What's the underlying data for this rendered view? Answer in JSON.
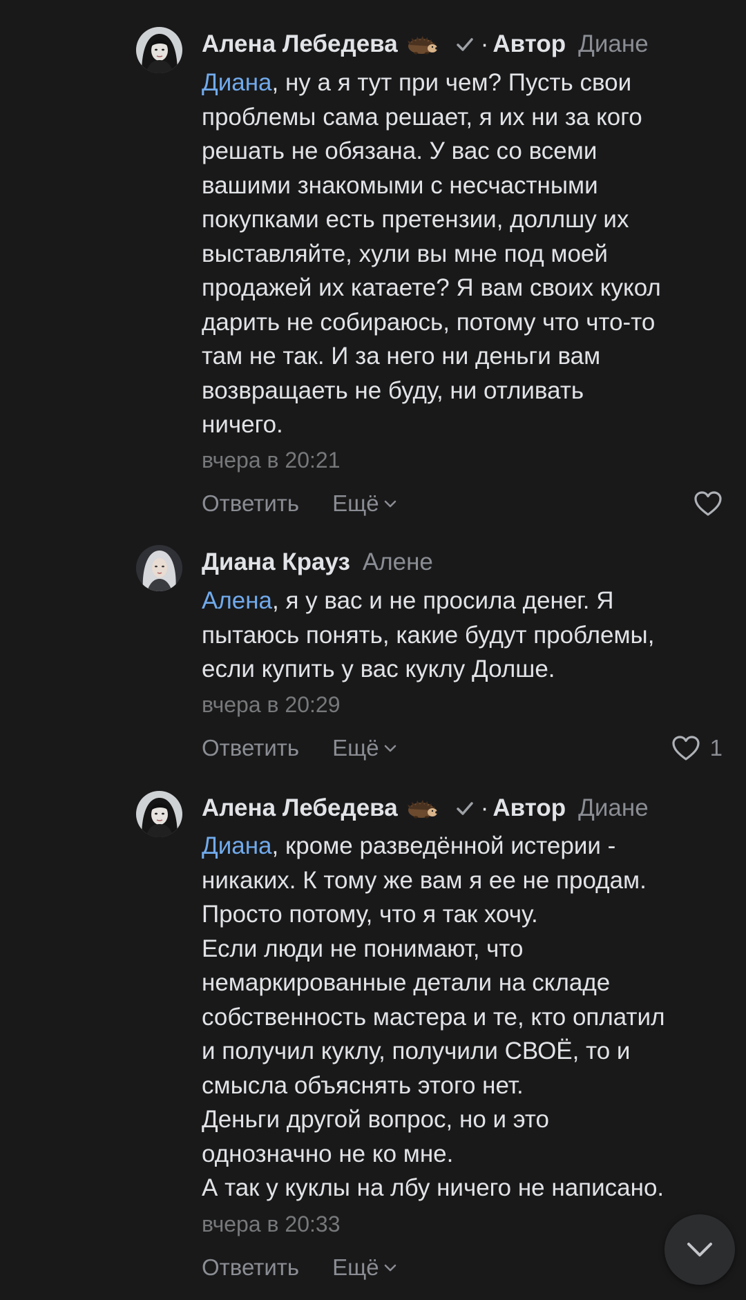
{
  "comments": [
    {
      "author": "Алена Лебедева",
      "badge_emoji": "hedgehog-icon",
      "verified": true,
      "role": "Автор",
      "dot": "·",
      "reply_to": "Диане",
      "mention": "Диана",
      "lines": [
        ", ну а я тут при чем? Пусть свои",
        "проблемы сама решает, я их ни за кого",
        "решать не обязана. У вас со всеми",
        "вашими знакомыми с несчастными",
        "покупками есть претензии, доллшу их",
        "выставляйте, хули вы мне под моей",
        "продажей их катаете? Я вам своих кукол",
        "дарить не собираюсь, потому что что-то",
        "там не так. И за него ни деньги вам",
        "возвращаеть не буду, ни отливать",
        "ничего."
      ],
      "time": "вчера в 20:21",
      "reply_label": "Ответить",
      "more_label": "Ещё",
      "likes": ""
    },
    {
      "author": "Диана Крауз",
      "reply_to": "Алене",
      "mention": "Алена",
      "lines": [
        ", я у вас и не просила денег. Я",
        "пытаюсь понять, какие будут проблемы,",
        "если купить у вас куклу Долше."
      ],
      "time": "вчера в 20:29",
      "reply_label": "Ответить",
      "more_label": "Ещё",
      "likes": "1"
    },
    {
      "author": "Алена Лебедева",
      "badge_emoji": "hedgehog-icon",
      "verified": true,
      "role": "Автор",
      "dot": "·",
      "reply_to": "Диане",
      "mention": "Диана",
      "lines": [
        ", кроме разведённой истерии -",
        "никаких. К тому же вам я ее не продам.",
        "Просто потому, что я так хочу.",
        "Если люди не понимают, что",
        "немаркированные детали на складе",
        "собственность мастера и те, кто оплатил",
        "и получил куклу, получили СВОЁ, то и",
        "смысла объяснять этого нет.",
        "Деньги другой вопрос, но и это",
        "однозначно не ко мне.",
        "А так у куклы на лбу ничего не написано."
      ],
      "time": "вчера в 20:33",
      "reply_label": "Ответить",
      "more_label": "Ещё",
      "likes": ""
    }
  ],
  "colors": {
    "background": "#19191a",
    "text": "#e1e3e6",
    "mention": "#71aaeb",
    "secondary": "#76787a"
  }
}
